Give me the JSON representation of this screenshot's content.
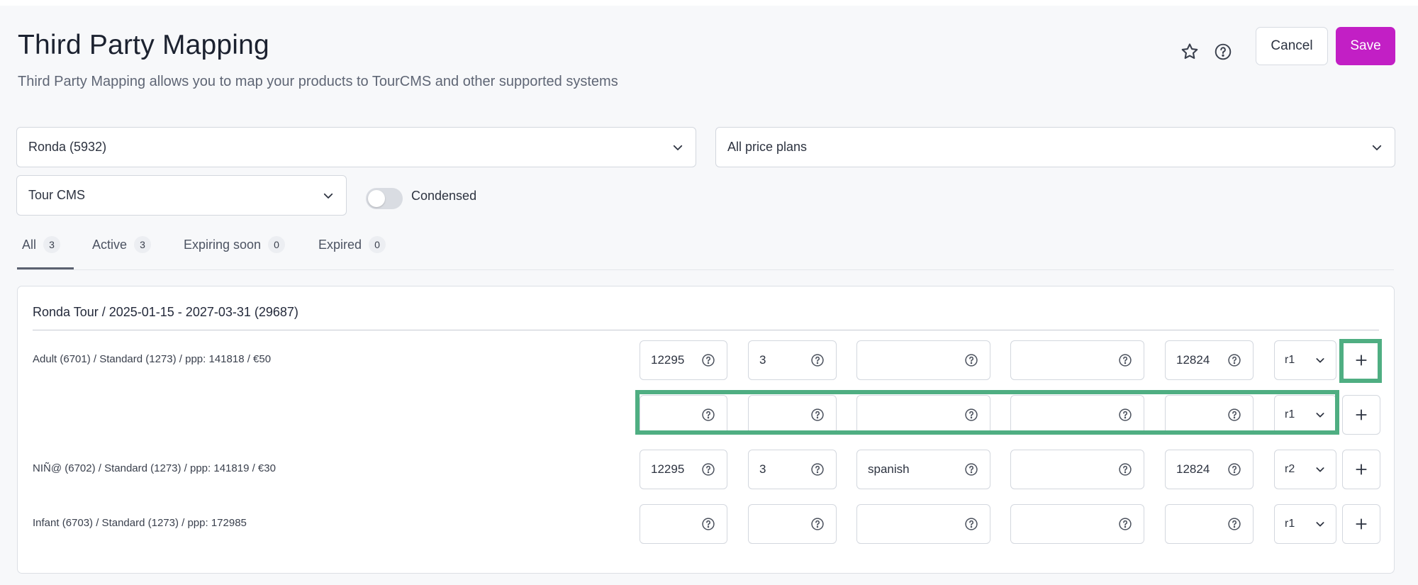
{
  "header": {
    "title": "Third Party Mapping",
    "subtitle": "Third Party Mapping allows you to map your products to TourCMS and other supported systems",
    "cancel_label": "Cancel",
    "save_label": "Save",
    "accent_color": "#c21fc5"
  },
  "filters": {
    "product": "Ronda (5932)",
    "price_plan": "All price plans",
    "system": "Tour CMS",
    "condensed_label": "Condensed",
    "condensed_on": false
  },
  "tabs": [
    {
      "label": "All",
      "count": "3"
    },
    {
      "label": "Active",
      "count": "3"
    },
    {
      "label": "Expiring soon",
      "count": "0"
    },
    {
      "label": "Expired",
      "count": "0"
    }
  ],
  "card": {
    "title": "Ronda Tour / 2025-01-15 - 2027-03-31 (29687)",
    "rows": [
      {
        "label": "Adult (6701) / Standard (1273) / ppp: 141818 / €50",
        "f1": "12295",
        "f2": "3",
        "f3": "",
        "f4": "",
        "f5": "12824",
        "rate": "r1"
      },
      {
        "label": "",
        "f1": "",
        "f2": "",
        "f3": "",
        "f4": "",
        "f5": "",
        "rate": "r1"
      },
      {
        "label": "NIÑ@ (6702) / Standard (1273) / ppp: 141819 / €30",
        "f1": "12295",
        "f2": "3",
        "f3": "spanish",
        "f4": "",
        "f5": "12824",
        "rate": "r2"
      },
      {
        "label": "Infant (6703) / Standard (1273) / ppp: 172985",
        "f1": "",
        "f2": "",
        "f3": "",
        "f4": "",
        "f5": "",
        "rate": "r1"
      }
    ]
  },
  "icons": {
    "favorite": "star-icon",
    "help": "help-circle-icon",
    "dropdown": "chevron-down-icon",
    "add": "plus-icon"
  },
  "highlight_color": "#4fae82"
}
